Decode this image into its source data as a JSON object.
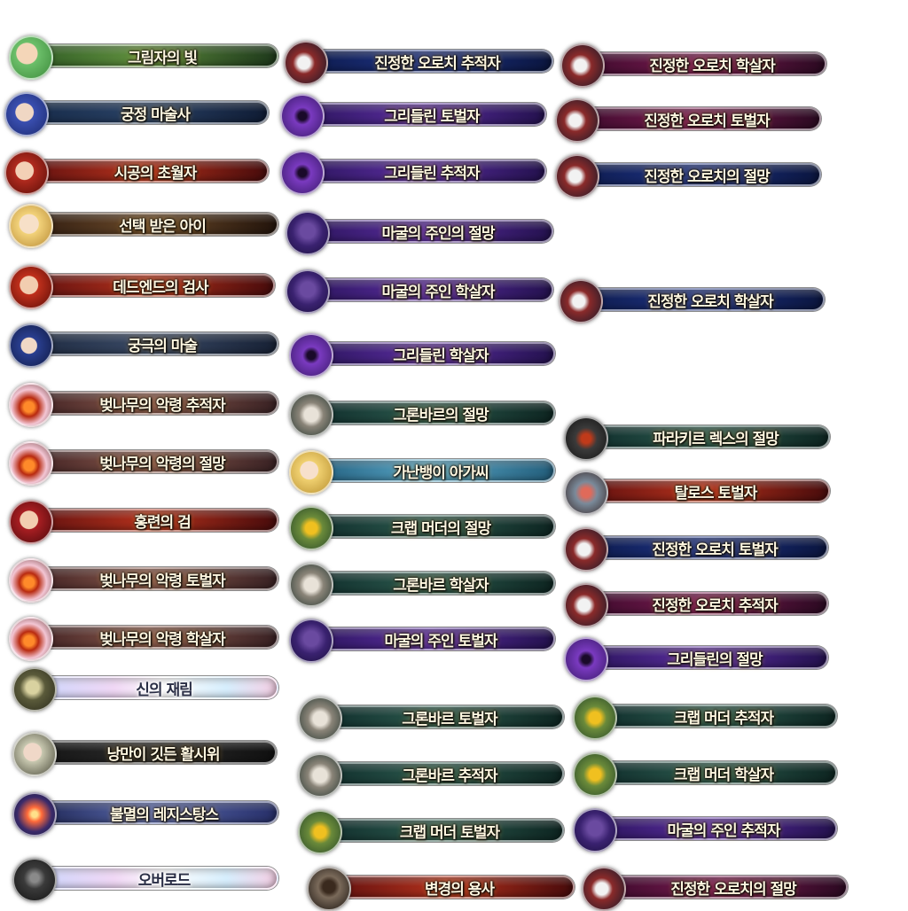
{
  "badges": [
    {
      "label": "그림자의 빛",
      "theme": "green",
      "portrait": "green-hair-girl"
    },
    {
      "label": "궁정 마술사",
      "theme": "navy",
      "portrait": "blue-hair-mage"
    },
    {
      "label": "시공의 초월자",
      "theme": "red",
      "portrait": "red-horned-girl"
    },
    {
      "label": "선택 받은 아이",
      "theme": "brown",
      "portrait": "blonde-child"
    },
    {
      "label": "데드엔드의 검사",
      "theme": "red",
      "portrait": "red-hair-swordswoman"
    },
    {
      "label": "궁극의 마술",
      "theme": "slate",
      "portrait": "blue-hat-witch"
    },
    {
      "label": "벚나무의 악령 추적자",
      "theme": "rose",
      "portrait": "cherry-tree-spirit"
    },
    {
      "label": "벚나무의 악령의 절망",
      "theme": "rose",
      "portrait": "cherry-tree-spirit"
    },
    {
      "label": "홍련의 검",
      "theme": "red",
      "portrait": "crimson-swordswoman"
    },
    {
      "label": "벚나무의 악령 토벌자",
      "theme": "rose",
      "portrait": "cherry-tree-spirit"
    },
    {
      "label": "벚나무의 악령 학살자",
      "theme": "rose",
      "portrait": "cherry-tree-spirit"
    },
    {
      "label": "신의 재림",
      "theme": "rainbow",
      "portrait": "emblem-warrior"
    },
    {
      "label": "낭만이 깃든 활시위",
      "theme": "dark",
      "portrait": "elf-archer"
    },
    {
      "label": "불멸의 레지스탕스",
      "theme": "fireworks",
      "portrait": "fireworks"
    },
    {
      "label": "오버로드",
      "theme": "rainbow",
      "portrait": "dark-knight"
    },
    {
      "label": "진정한 오로치 추적자",
      "theme": "blue",
      "portrait": "orochi"
    },
    {
      "label": "그리들린 토벌자",
      "theme": "purple",
      "portrait": "grimlin"
    },
    {
      "label": "그리들린 추적자",
      "theme": "purple",
      "portrait": "grimlin"
    },
    {
      "label": "마굴의 주인의 절망",
      "theme": "purple",
      "portrait": "cave-lord"
    },
    {
      "label": "마굴의 주인 학살자",
      "theme": "purple",
      "portrait": "cave-lord"
    },
    {
      "label": "그리들린 학살자",
      "theme": "purple",
      "portrait": "grimlin"
    },
    {
      "label": "그론바르의 절망",
      "theme": "teal",
      "portrait": "gronvar"
    },
    {
      "label": "가난뱅이 아가씨",
      "theme": "sky",
      "portrait": "blonde-girl"
    },
    {
      "label": "크랩 머더의 절망",
      "theme": "teal",
      "portrait": "crab-mother"
    },
    {
      "label": "그론바르 학살자",
      "theme": "teal",
      "portrait": "gronvar"
    },
    {
      "label": "마굴의 주인 토벌자",
      "theme": "purple",
      "portrait": "cave-lord"
    },
    {
      "label": "그론바르 토벌자",
      "theme": "teal",
      "portrait": "gronvar"
    },
    {
      "label": "그론바르 추적자",
      "theme": "teal",
      "portrait": "gronvar"
    },
    {
      "label": "크랩 머더 토벌자",
      "theme": "teal",
      "portrait": "crab-mother"
    },
    {
      "label": "변경의 용사",
      "theme": "red",
      "portrait": "frontier-hero"
    },
    {
      "label": "진정한 오로치 학살자",
      "theme": "magenta",
      "portrait": "orochi"
    },
    {
      "label": "진정한 오로치 토벌자",
      "theme": "magenta",
      "portrait": "orochi"
    },
    {
      "label": "진정한 오로치의 절망",
      "theme": "blue",
      "portrait": "orochi"
    },
    {
      "label": "진정한 오로치 학살자",
      "theme": "blue",
      "portrait": "orochi"
    },
    {
      "label": "파라키르 렉스의 절망",
      "theme": "teal",
      "portrait": "parakir-rex"
    },
    {
      "label": "탈로스 토벌자",
      "theme": "red",
      "portrait": "talos"
    },
    {
      "label": "진정한 오로치 토벌자",
      "theme": "blue",
      "portrait": "orochi"
    },
    {
      "label": "진정한 오로치 추적자",
      "theme": "magenta",
      "portrait": "orochi"
    },
    {
      "label": "그리들린의 절망",
      "theme": "purple",
      "portrait": "grimlin"
    },
    {
      "label": "크랩 머더 추적자",
      "theme": "teal",
      "portrait": "crab-mother"
    },
    {
      "label": "크랩 머더 학살자",
      "theme": "teal",
      "portrait": "crab-mother"
    },
    {
      "label": "마굴의 주인 추적자",
      "theme": "purple",
      "portrait": "cave-lord"
    },
    {
      "label": "진정한 오로치의 절망",
      "theme": "magenta",
      "portrait": "orochi"
    }
  ]
}
